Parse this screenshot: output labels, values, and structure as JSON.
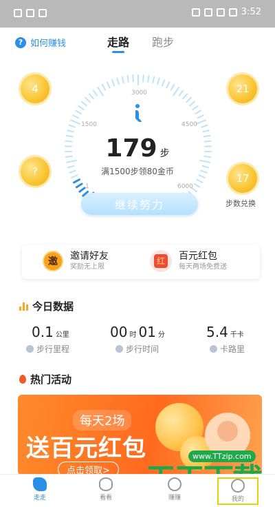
{
  "status_bar": {
    "time": "3:52"
  },
  "header": {
    "help_label": "如何赚钱",
    "help_icon": "?",
    "tabs": [
      "走路",
      "跑步"
    ]
  },
  "hero": {
    "coins_left": [
      "4",
      "?"
    ],
    "coins_right": [
      "21",
      "17"
    ],
    "exchange_label": "步数兑换",
    "gauge_ticks": [
      "1",
      "1500",
      "3000",
      "4500",
      "6000"
    ],
    "steps": "179",
    "steps_unit": "步",
    "reward_text": "满1500步领80金币",
    "continue_button": "继续努力"
  },
  "promo": {
    "invite": {
      "icon": "邀",
      "title": "邀请好友",
      "subtitle": "奖励无上限"
    },
    "red_packet": {
      "icon": "红",
      "title": "百元红包",
      "subtitle": "每天两场免费送"
    }
  },
  "today": {
    "title": "今日数据",
    "stats": [
      {
        "value": "0.1",
        "unit": "公里",
        "label": "步行里程"
      },
      {
        "value_hours": "00",
        "unit_hours": "时",
        "value_minutes": "01",
        "unit_minutes": "分",
        "label": "步行时间"
      },
      {
        "value": "5.4",
        "unit": "千卡",
        "label": "卡路里"
      }
    ]
  },
  "hot": {
    "title": "热门活动",
    "banner": {
      "line1": "每天2场",
      "line2": "送百元红包",
      "cta": "点击领取>"
    }
  },
  "watermark": {
    "url": "www.TTzip.com",
    "text": "天天下载"
  },
  "bottom_nav": [
    "走走",
    "看看",
    "赚赚",
    "我的"
  ],
  "colors": {
    "accent": "#2b8fe8",
    "coin": "#f9c431",
    "banner": "#ff6a1f"
  }
}
